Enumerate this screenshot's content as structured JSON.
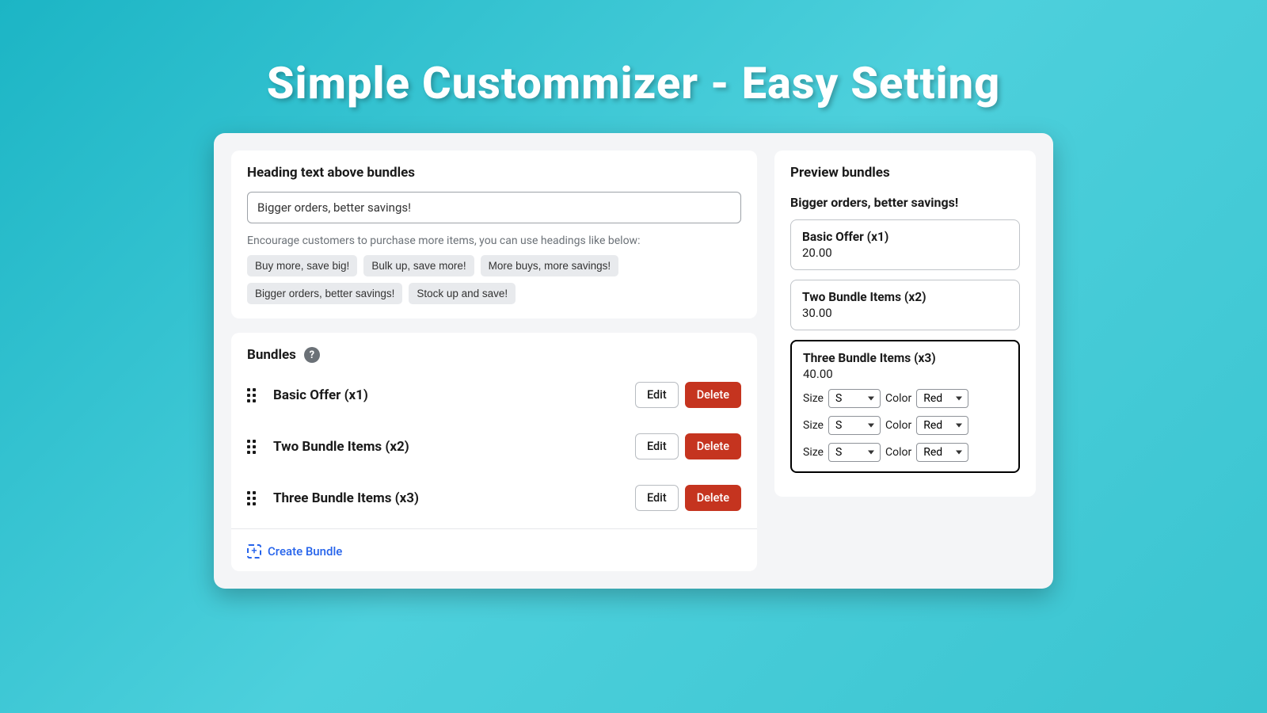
{
  "hero_title": "Simple Custommizer -  Easy Setting",
  "heading_card": {
    "label": "Heading text above bundles",
    "input_value": "Bigger orders, better savings!",
    "helper": "Encourage customers to purchase more items, you can use headings like below:",
    "chips": [
      "Buy more, save big!",
      "Bulk up, save more!",
      "More buys, more savings!",
      "Bigger orders, better savings!",
      "Stock up and save!"
    ]
  },
  "bundles_card": {
    "label": "Bundles",
    "edit_label": "Edit",
    "delete_label": "Delete",
    "create_label": "Create Bundle",
    "items": [
      {
        "name": "Basic Offer (x1)"
      },
      {
        "name": "Two Bundle Items (x2)"
      },
      {
        "name": "Three Bundle Items (x3)"
      }
    ]
  },
  "preview": {
    "title": "Preview bundles",
    "heading": "Bigger orders, better savings!",
    "size_label": "Size",
    "color_label": "Color",
    "size_value": "S",
    "color_value": "Red",
    "boxes": [
      {
        "title": "Basic Offer (x1)",
        "price": "20.00",
        "variants": 0,
        "selected": false
      },
      {
        "title": "Two Bundle Items (x2)",
        "price": "30.00",
        "variants": 0,
        "selected": false
      },
      {
        "title": "Three Bundle Items (x3)",
        "price": "40.00",
        "variants": 3,
        "selected": true
      }
    ]
  }
}
